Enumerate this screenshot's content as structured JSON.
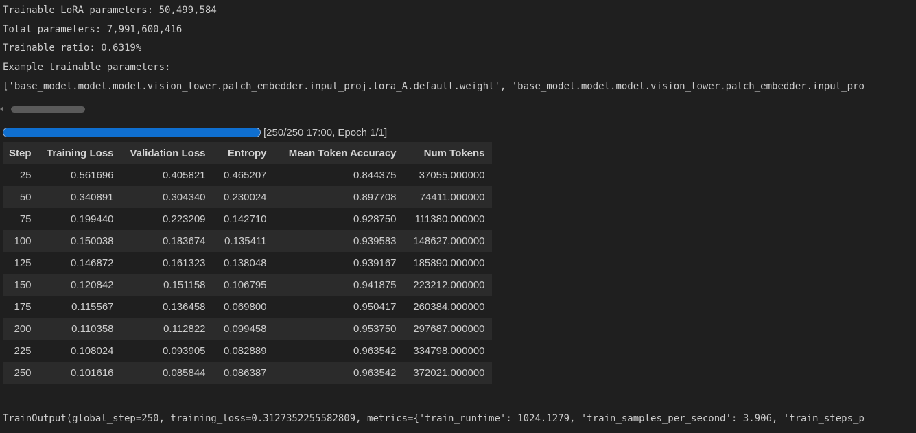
{
  "output": {
    "lines": [
      "Trainable LoRA parameters: 50,499,584",
      "Total parameters: 7,991,600,416",
      "Trainable ratio: 0.6319%",
      "Example trainable parameters:",
      "['base_model.model.model.vision_tower.patch_embedder.input_proj.lora_A.default.weight', 'base_model.model.model.vision_tower.patch_embedder.input_pro"
    ],
    "train_output": "TrainOutput(global_step=250, training_loss=0.3127352255582809, metrics={'train_runtime': 1024.1279, 'train_samples_per_second': 3.906, 'train_steps_p"
  },
  "progress": {
    "fraction": 1.0,
    "text": "[250/250 17:00, Epoch 1/1]",
    "fill_color": "#0f6fd0"
  },
  "table": {
    "headers": [
      "Step",
      "Training Loss",
      "Validation Loss",
      "Entropy",
      "Mean Token Accuracy",
      "Num Tokens"
    ],
    "rows": [
      [
        "25",
        "0.561696",
        "0.405821",
        "0.465207",
        "0.844375",
        "37055.000000"
      ],
      [
        "50",
        "0.340891",
        "0.304340",
        "0.230024",
        "0.897708",
        "74411.000000"
      ],
      [
        "75",
        "0.199440",
        "0.223209",
        "0.142710",
        "0.928750",
        "111380.000000"
      ],
      [
        "100",
        "0.150038",
        "0.183674",
        "0.135411",
        "0.939583",
        "148627.000000"
      ],
      [
        "125",
        "0.146872",
        "0.161323",
        "0.138048",
        "0.939167",
        "185890.000000"
      ],
      [
        "150",
        "0.120842",
        "0.151158",
        "0.106795",
        "0.941875",
        "223212.000000"
      ],
      [
        "175",
        "0.115567",
        "0.136458",
        "0.069800",
        "0.950417",
        "260384.000000"
      ],
      [
        "200",
        "0.110358",
        "0.112822",
        "0.099458",
        "0.953750",
        "297687.000000"
      ],
      [
        "225",
        "0.108024",
        "0.093905",
        "0.082889",
        "0.963542",
        "334798.000000"
      ],
      [
        "250",
        "0.101616",
        "0.085844",
        "0.086387",
        "0.963542",
        "372021.000000"
      ]
    ]
  },
  "icons": {
    "scroll_left": "chevron-left-icon"
  }
}
